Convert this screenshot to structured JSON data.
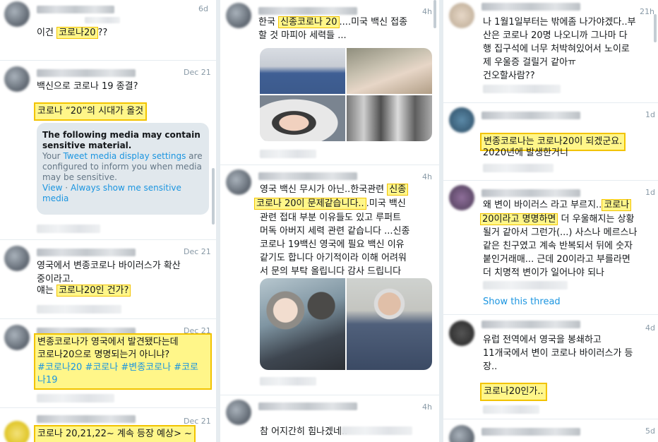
{
  "col1": {
    "t1": {
      "time": "6d",
      "text_pre": "이건 ",
      "hl": "코로나20",
      "text_post": "??"
    },
    "t2": {
      "time": "Dec 21",
      "text": "백신으로 코로나 19 종결?",
      "hl": "코로나 “20”의 시대가 올것",
      "sensitive": {
        "title": "The following media may contain sensitive material.",
        "pre": "Your ",
        "link": "Tweet media display settings",
        "post": " are configured to inform you when media may be sensitive.",
        "view": "View",
        "dot": " · ",
        "always": "Always show me sensitive media"
      }
    },
    "t3": {
      "time": "Dec 21",
      "text": "영국에서 변종코로나 바이러스가 확산\n중이라고.",
      "text2_pre": "얘는 ",
      "hl": "코로나20인 건가?"
    },
    "t4": {
      "time": "Dec 21",
      "line1": "변종코로나가 영국에서 발견됐다는데",
      "line2": "코로나20으로 명명되는거 아니냐?",
      "tags1": "#코로나20 #코로나 #변종코로나 #코로",
      "tags2": "나19"
    },
    "t5": {
      "time": "Dec 21",
      "hl": "코로나 20,21,22~ 계속 등장 예상> ~"
    }
  },
  "col2": {
    "t1": {
      "time": "4h",
      "pre": "한국 ",
      "hl": "신종코로나 20",
      "post": "....미국 백신 접종",
      "line2": "할 것 마피아 세력들 ..."
    },
    "t2": {
      "time": "4h",
      "pre": "영국 백신 무시가 아닌..한국관련 ",
      "hl1": "신종",
      "hl2": "코로나 20이 문제같습니다..",
      "post2": ".미국 백신",
      "rest": "관련 접대 부분 이유들도 있고 루퍼트\n머독 아버지 세력 관련 같습니다 ...신종\n코로나 19백신 영국에 필요 백신 이유\n같기도 합니다 아기적이라 이해 어려워\n서 문의 부탁 올립니다 감사 드립니다"
    },
    "t3": {
      "time": "4h",
      "text": "참 어지간히 힘나겠네.."
    }
  },
  "col3": {
    "t1": {
      "time": "21h",
      "text": "나 1월1일부터는 밖에좀 나가야겠다..부\n산은 코로나 20명 나오니까 그나마 다\n행 집구석에 너무 처박혀있어서 노이로\n제 우울증 걸릴거 같아ㅠ\n건오할사람??"
    },
    "t2": {
      "time": "1d",
      "hl": "변종코로나는 코로나20이 되겠군요.",
      "text": "2020년에 발생한거니"
    },
    "t3": {
      "time": "1d",
      "pre": "왜 변이 바이러스 라고 부르지..",
      "hl1": "코로나",
      "hl2": "20이라고 명명하면",
      "post2": " 더 우울해지는 상황",
      "rest": "될거 같아서 그런가(...) 사스나 메르스나\n같은 친구였고 계속 반복되서 뒤에 숫자\n붙인거래매... 근데 20이라고 부를라면\n더 치명적 변이가 일어나야 되나",
      "show": "Show this thread"
    },
    "t4": {
      "time": "4d",
      "text": "유럽 전역에서 영국을 봉쇄하고\n11개국에서 변이 코로나 바이러스가 등\n장..",
      "hl": "코로나20인가.."
    },
    "t5": {
      "time": "5d"
    }
  }
}
